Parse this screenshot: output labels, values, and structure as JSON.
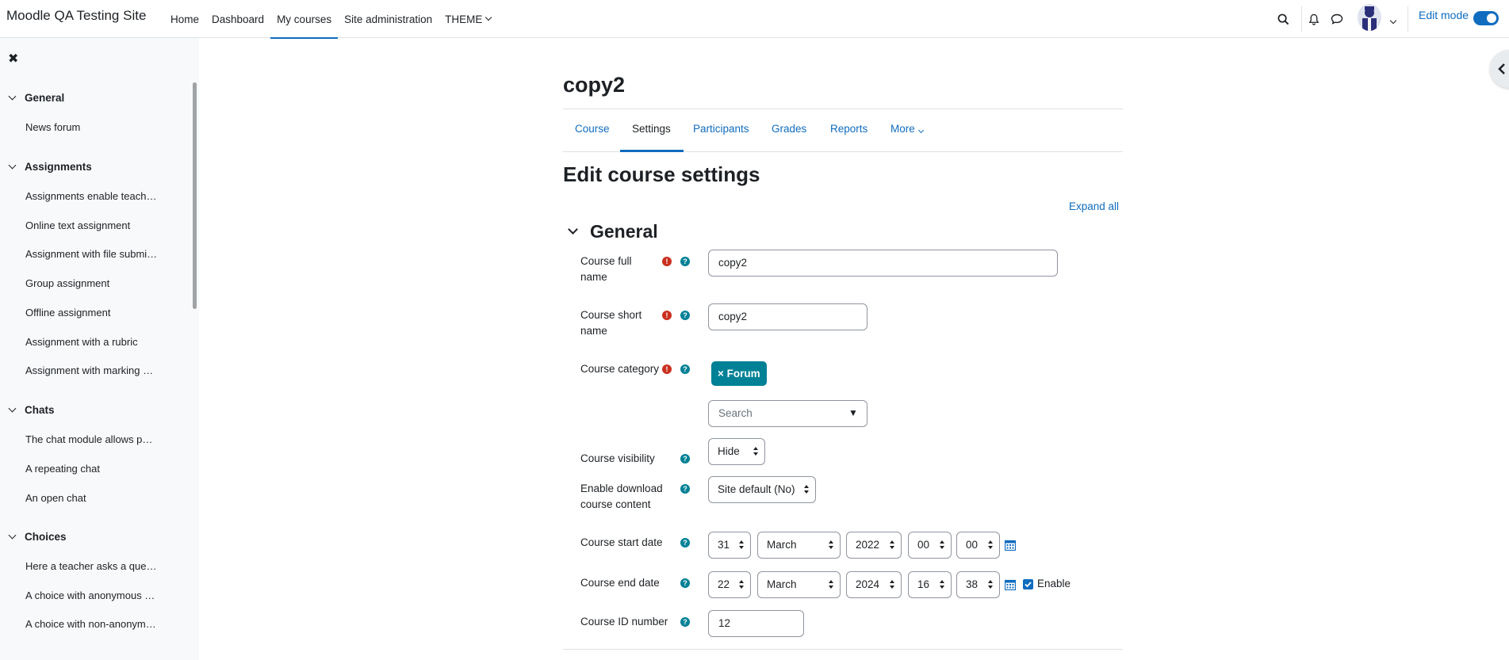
{
  "navbar": {
    "brand": "Moodle QA Testing Site",
    "items": [
      "Home",
      "Dashboard",
      "My courses",
      "Site administration",
      "THEME"
    ],
    "active_index": 2,
    "edit_mode_label": "Edit mode",
    "edit_mode_on": true,
    "icons": [
      "search-icon",
      "bell-icon",
      "chat-icon",
      "user-avatar",
      "chevron-down-icon"
    ]
  },
  "drawer": {
    "sections": [
      {
        "title": "General",
        "items": [
          "News forum"
        ]
      },
      {
        "title": "Assignments",
        "items": [
          "Assignments enable teach…",
          "Online text assignment",
          "Assignment with file submi…",
          "Group assignment",
          "Offline assignment",
          "Assignment with a rubric",
          "Assignment with marking …"
        ]
      },
      {
        "title": "Chats",
        "items": [
          "The chat module allows p…",
          "A repeating chat",
          "An open chat"
        ]
      },
      {
        "title": "Choices",
        "items": [
          "Here a teacher asks a que…",
          "A choice with anonymous …",
          "A choice with non-anonym…"
        ]
      }
    ]
  },
  "course": {
    "title": "copy2",
    "tabs": [
      "Course",
      "Settings",
      "Participants",
      "Grades",
      "Reports",
      "More"
    ],
    "active_tab": 1
  },
  "page": {
    "heading": "Edit course settings",
    "expand_all": "Expand all",
    "section_title": "General"
  },
  "form": {
    "fullname": {
      "label": "Course full name",
      "value": "copy2"
    },
    "shortname": {
      "label": "Course short name",
      "value": "copy2"
    },
    "category": {
      "label": "Course category",
      "selected": "× Forum",
      "search_placeholder": "Search",
      "dropdown_glyph": "▼"
    },
    "visibility": {
      "label": "Course visibility",
      "value": "Hide"
    },
    "download": {
      "label": "Enable download course content",
      "value": "Site default (No)"
    },
    "startdate": {
      "label": "Course start date",
      "day": "31",
      "month": "March",
      "year": "2022",
      "hour": "00",
      "minute": "00"
    },
    "enddate": {
      "label": "Course end date",
      "day": "22",
      "month": "March",
      "year": "2024",
      "hour": "16",
      "minute": "38",
      "enable_label": "Enable",
      "enabled": true
    },
    "idnumber": {
      "label": "Course ID number",
      "value": "12"
    }
  }
}
